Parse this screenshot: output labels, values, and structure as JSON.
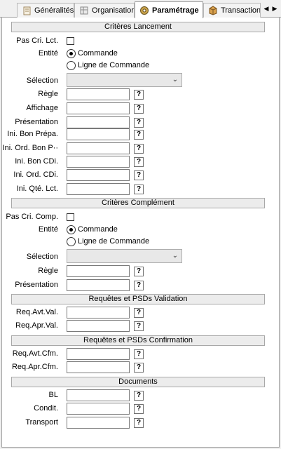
{
  "tabs": [
    {
      "label": "Généralités",
      "icon": "generalites-icon"
    },
    {
      "label": "Organisation",
      "icon": "organisation-icon"
    },
    {
      "label": "Paramétrage",
      "icon": "parametrage-gear-icon",
      "active": true
    },
    {
      "label": "Transaction",
      "icon": "transaction-box-icon"
    }
  ],
  "tab_scroll": {
    "left": "◀",
    "right": "▶"
  },
  "lancement": {
    "title": "Critères Lancement",
    "pas_cri_label": "Pas Cri. Lct.",
    "entite_label": "Entité",
    "radio_commande": "Commande",
    "radio_ligne": "Ligne de Commande",
    "selection_label": "Sélection",
    "fields": [
      "Règle",
      "Affichage",
      "Présentation",
      "Ini. Bon Prépa.",
      "Ini. Ord. Bon P··",
      "Ini. Bon CDi.",
      "Ini. Ord. CDi.",
      "Ini. Qté. Lct."
    ]
  },
  "complement": {
    "title": "Critères Complément",
    "pas_cri_label": "Pas Cri. Comp.",
    "entite_label": "Entité",
    "radio_commande": "Commande",
    "radio_ligne": "Ligne de Commande",
    "selection_label": "Sélection",
    "fields": [
      "Règle",
      "Présentation"
    ]
  },
  "validation": {
    "title": "Requêtes et PSDs Validation",
    "fields": [
      "Req.Avt.Val.",
      "Req.Apr.Val."
    ]
  },
  "confirmation": {
    "title": "Requêtes et PSDs Confirmation",
    "fields": [
      "Req.Avt.Cfm.",
      "Req.Apr.Cfm."
    ]
  },
  "documents": {
    "title": "Documents",
    "fields": [
      "BL",
      "Condit.",
      "Transport"
    ]
  },
  "help_label": "?",
  "chevron": "⌄",
  "colors": {
    "panel_bg": "#ffffff",
    "section_bg": "#ececec",
    "window_bg": "#f0f0f0"
  }
}
